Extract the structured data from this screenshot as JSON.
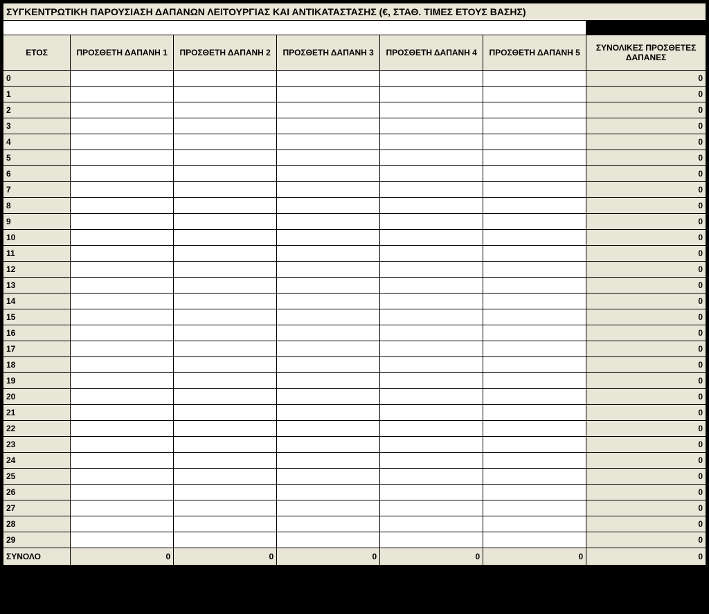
{
  "title": "ΣΥΓΚΕΝΤΡΩΤΙΚΗ ΠΑΡΟΥΣΙΑΣΗ ΔΑΠΑΝΩΝ ΛΕΙΤΟΥΡΓΙΑΣ ΚΑΙ ΑΝΤΙΚΑΤΑΣΤΑΣΗΣ (€,  ΣΤΑΘ. ΤΙΜΕΣ ΕΤΟΥΣ ΒΑΣΗΣ)",
  "headers": {
    "year": "ΕΤΟΣ",
    "col1": "ΠΡΟΣΘΕΤΗ ΔΑΠΑΝΗ 1",
    "col2": "ΠΡΟΣΘΕΤΗ ΔΑΠΑΝΗ 2",
    "col3": "ΠΡΟΣΘΕΤΗ ΔΑΠΑΝΗ 3",
    "col4": "ΠΡΟΣΘΕΤΗ ΔΑΠΑΝΗ 4",
    "col5": "ΠΡΟΣΘΕΤΗ ΔΑΠΑΝΗ 5",
    "total": "ΣΥΝΟΛΙΚΕΣ ΠΡΟΣΘΕΤΕΣ ΔΑΠΑΝΕΣ"
  },
  "years": [
    "0",
    "1",
    "2",
    "3",
    "4",
    "5",
    "6",
    "7",
    "8",
    "9",
    "10",
    "11",
    "12",
    "13",
    "14",
    "15",
    "16",
    "17",
    "18",
    "19",
    "20",
    "21",
    "22",
    "23",
    "24",
    "25",
    "26",
    "27",
    "28",
    "29"
  ],
  "row_total_value": "0",
  "sum_row": {
    "label": "ΣΥΝΟΛΟ",
    "c1": "0",
    "c2": "0",
    "c3": "0",
    "c4": "0",
    "c5": "0",
    "total": "0"
  },
  "footer": {
    "line1": "",
    "line2": ""
  }
}
